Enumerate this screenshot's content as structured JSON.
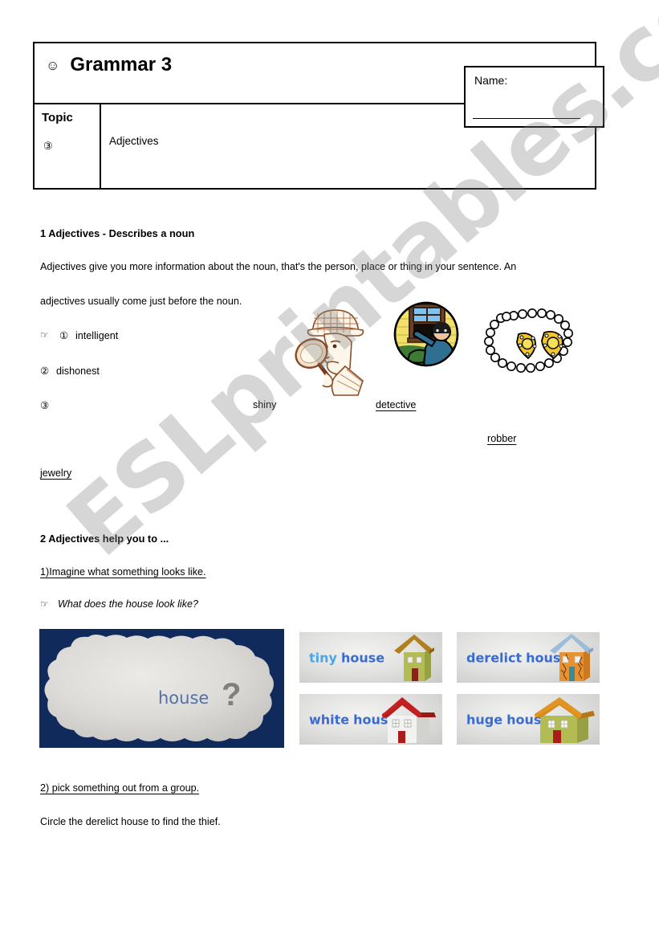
{
  "header": {
    "smiley_icon": "☺",
    "title": "Grammar 3",
    "topic_label": "Topic",
    "topic_number": "③",
    "topic_value": "Adjectives",
    "name_label": "Name:"
  },
  "section1": {
    "heading": "1 Adjectives - Describes a noun",
    "paragraph_line1": "Adjectives give you more information about the noun, that's the person, place or thing in your sentence. An",
    "paragraph_line2": "adjectives usually come just before the noun.",
    "hand_icon": "☞",
    "items": [
      {
        "number": "①",
        "label": "intelligent"
      },
      {
        "number": "②",
        "label": "dishonest"
      },
      {
        "number": "③",
        "label": ""
      }
    ],
    "image_captions": {
      "shiny": "shiny",
      "detective": "detective",
      "robber": "robber",
      "jewelry": "jewelry"
    },
    "clipart": [
      {
        "name": "detective-clipart",
        "alt": "detective with magnifying glass"
      },
      {
        "name": "robber-clipart",
        "alt": "robber climbing through window"
      },
      {
        "name": "jewelry-clipart",
        "alt": "pearl necklace with gold pendants"
      }
    ]
  },
  "section2": {
    "heading": "2 Adjectives help you to ...",
    "sub1": "1)Imagine what something looks like.",
    "hand_icon": "☞",
    "question": "What does the house look like?",
    "cloud": {
      "word": "house",
      "question_mark": "?",
      "background_color": "#102a5c",
      "cloud_color": "#d6d6d4",
      "word_color": "#4f71ab"
    },
    "house_cards": [
      {
        "adjective": "tiny",
        "noun": "house",
        "adj_color": "#49a6e8",
        "noun_color": "#3a6bd0",
        "body_color": "#b2bc52",
        "roof_color": "#b07f1e",
        "door_color": "#8b2020"
      },
      {
        "adjective": "derelict",
        "noun": "house",
        "adj_color": "#3a6bd0",
        "noun_color": "#3a6bd0",
        "body_color": "#e8912f",
        "roof_color": "#9dbcd8",
        "door_color": "#3a8a9e"
      },
      {
        "adjective": "white",
        "noun": "house",
        "adj_color": "#3a6bd0",
        "noun_color": "#3a6bd0",
        "body_color": "#dcdcda",
        "roof_color": "#b81c1c",
        "door_color": "#a81c1c"
      },
      {
        "adjective": "huge",
        "noun": "house",
        "adj_color": "#3a6bd0",
        "noun_color": "#3a6bd0",
        "body_color": "#b2bc52",
        "roof_color": "#d98a1e",
        "door_color": "#a81c1c"
      }
    ],
    "sub2": "2) pick something out from a group.",
    "instruction": "Circle the derelict house to find the thief."
  },
  "watermark": {
    "text": "ESLprintables.com"
  }
}
